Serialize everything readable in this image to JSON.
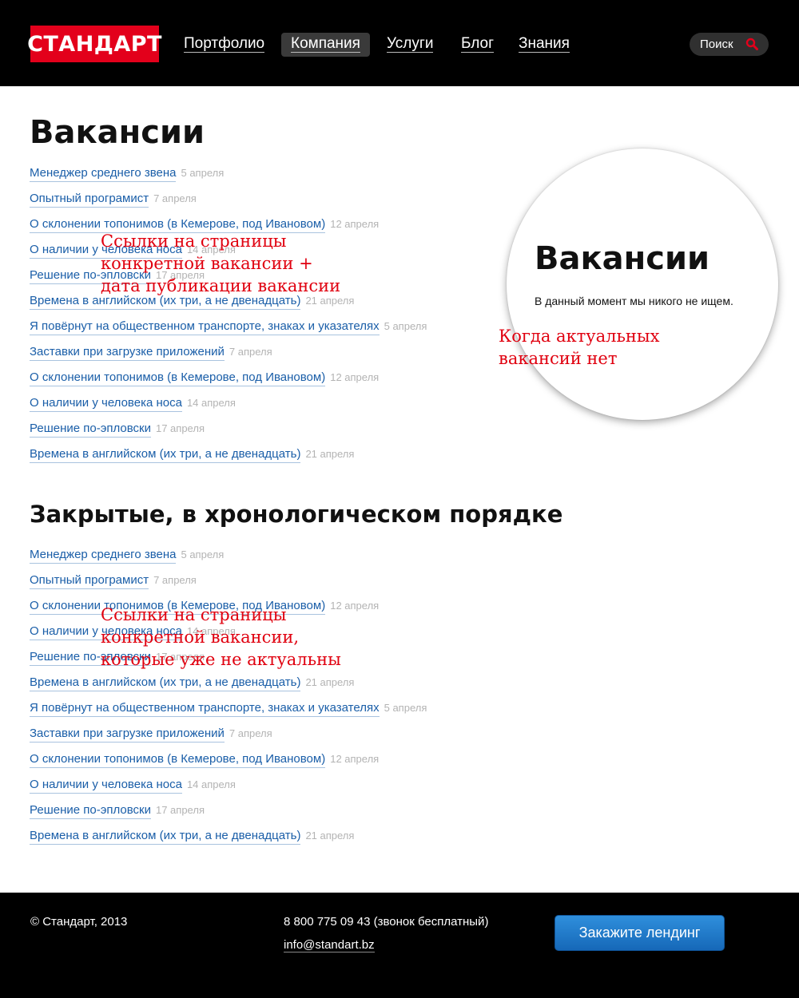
{
  "header": {
    "logo": "СТАНДАРТ",
    "nav": [
      {
        "label": "Портфолио",
        "active": false
      },
      {
        "label": "Компания",
        "active": true
      },
      {
        "label": "Услуги",
        "active": false
      },
      {
        "label": "Блог",
        "active": false
      },
      {
        "label": "Знания",
        "active": false
      }
    ],
    "search_label": "Поиск"
  },
  "main": {
    "title": "Вакансии",
    "open_vacancies": [
      {
        "title": "Менеджер среднего звена",
        "date": "5 апреля"
      },
      {
        "title": "Опытный програмист",
        "date": "7 апреля"
      },
      {
        "title": "О склонении топонимов (в Кемерове, под Ивановом)",
        "date": "12 апреля"
      },
      {
        "title": "О наличии у человека носа",
        "date": "14 апреля"
      },
      {
        "title": "Решение по-эпловски",
        "date": "17 апреля"
      },
      {
        "title": "Времена в английском (их три, а не двенадцать)",
        "date": "21 апреля"
      },
      {
        "title": "Я повёрнут на общественном транспорте, знаках и указателях",
        "date": "5 апреля"
      },
      {
        "title": "Заставки при загрузке приложений",
        "date": "7 апреля"
      },
      {
        "title": "О склонении топонимов (в Кемерове, под Ивановом)",
        "date": "12 апреля"
      },
      {
        "title": "О наличии у человека носа",
        "date": "14 апреля"
      },
      {
        "title": "Решение по-эпловски",
        "date": "17 апреля"
      },
      {
        "title": "Времена в английском (их три, а не двенадцать)",
        "date": "21 апреля"
      }
    ],
    "closed_title": "Закрытые, в хронологическом порядке",
    "closed_vacancies": [
      {
        "title": "Менеджер среднего звена",
        "date": "5 апреля"
      },
      {
        "title": "Опытный програмист",
        "date": "7 апреля"
      },
      {
        "title": "О склонении топонимов (в Кемерове, под Ивановом)",
        "date": "12 апреля"
      },
      {
        "title": "О наличии у человека носа",
        "date": "14 апреля"
      },
      {
        "title": "Решение по-эпловски",
        "date": "17 апреля"
      },
      {
        "title": "Времена в английском (их три, а не двенадцать)",
        "date": "21 апреля"
      },
      {
        "title": "Я повёрнут на общественном транспорте, знаках и указателях",
        "date": "5 апреля"
      },
      {
        "title": "Заставки при загрузке приложений",
        "date": "7 апреля"
      },
      {
        "title": "О склонении топонимов (в Кемерове, под Ивановом)",
        "date": "12 апреля"
      },
      {
        "title": "О наличии у человека носа",
        "date": "14 апреля"
      },
      {
        "title": "Решение по-эпловски",
        "date": "17 апреля"
      },
      {
        "title": "Времена в английском (их три, а не двенадцать)",
        "date": "21 апреля"
      }
    ]
  },
  "annotations": {
    "open_note": [
      "Ссылки на страницы",
      "конкретной вакансии +",
      "дата публикации вакансии"
    ],
    "closed_note": [
      "Ссылки на страницы",
      "конкретной вакансии,",
      "которые уже не актуальны"
    ],
    "empty_note": [
      "Когда актуальных",
      "вакансий нет"
    ]
  },
  "empty_state": {
    "title": "Вакансии",
    "text": "В данный момент мы никого не ищем."
  },
  "footer": {
    "copyright": "© Стандарт, 2013",
    "phone": "8 800 775 09 43 (звонок бесплатный)",
    "email": "info@standart.bz",
    "cta_label": "Закажите лендинг"
  },
  "colors": {
    "brand_red": "#e3001b",
    "link_blue": "#1a5ea8",
    "annotation_red": "#e0000f",
    "button_blue": "#1f7ccc"
  }
}
